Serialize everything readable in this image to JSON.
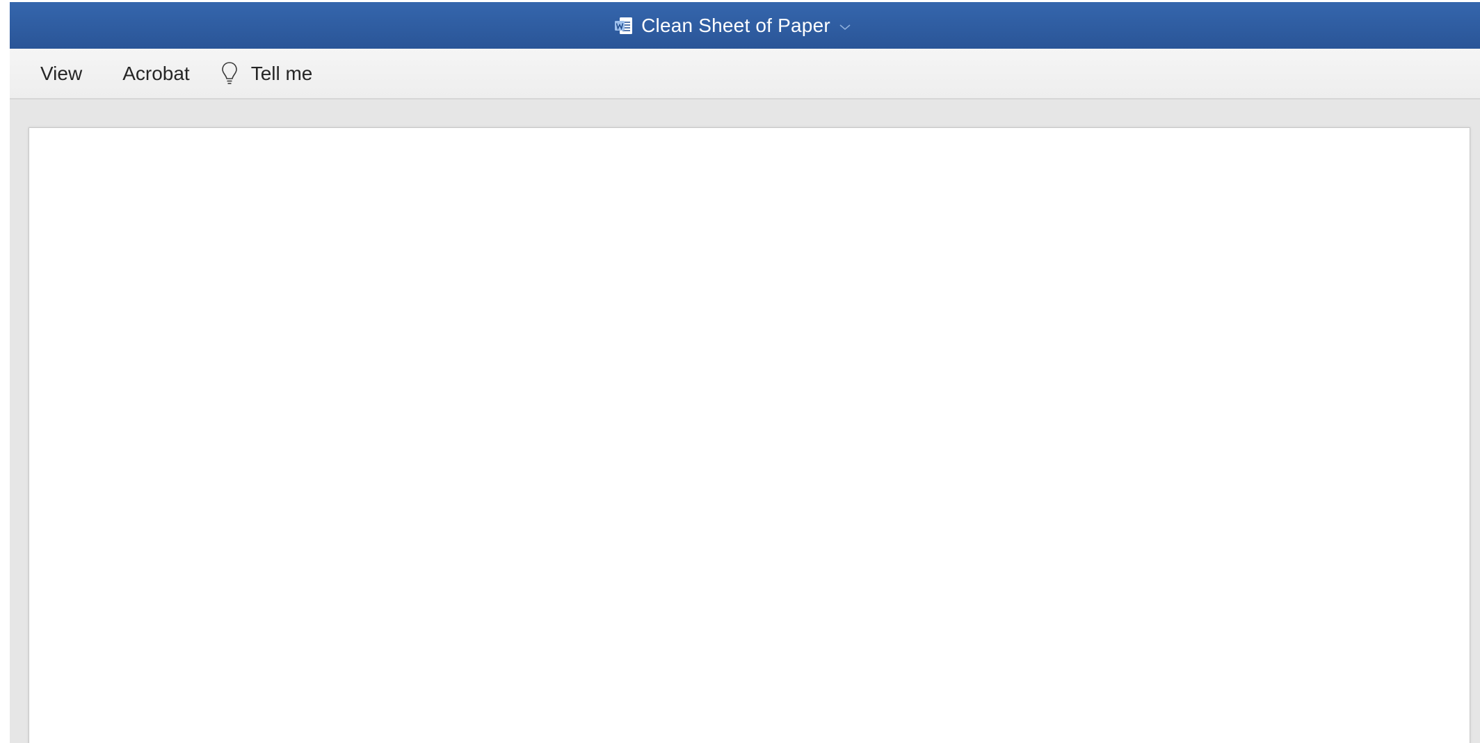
{
  "window": {
    "title": "Clean Sheet of Paper",
    "title_icon": "word-document-icon"
  },
  "ribbon": {
    "tabs": [
      {
        "label": "View"
      },
      {
        "label": "Acrobat"
      }
    ],
    "tell_me": {
      "label": "Tell me",
      "icon": "lightbulb-icon"
    }
  },
  "colors": {
    "title_bar": "#2b579a",
    "ribbon_background": "#f2f2f2",
    "canvas_background": "#e6e6e6",
    "page": "#ffffff"
  }
}
